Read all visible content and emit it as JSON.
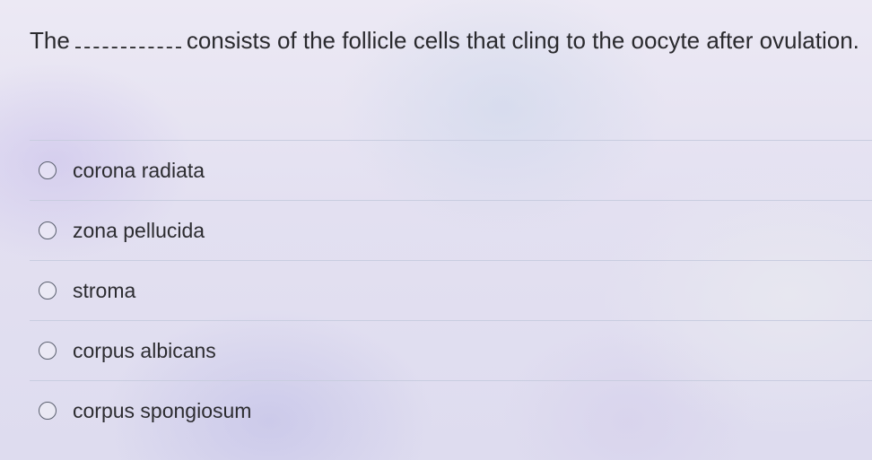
{
  "question": {
    "text_before": "The",
    "blank": "________",
    "text_after": "consists of the follicle cells that cling to the oocyte after ovulation."
  },
  "choices": [
    {
      "label": "corona radiata",
      "selected": false
    },
    {
      "label": "zona pellucida",
      "selected": false
    },
    {
      "label": "stroma",
      "selected": false
    },
    {
      "label": "corpus albicans",
      "selected": false
    },
    {
      "label": "corpus spongiosum",
      "selected": false
    }
  ]
}
